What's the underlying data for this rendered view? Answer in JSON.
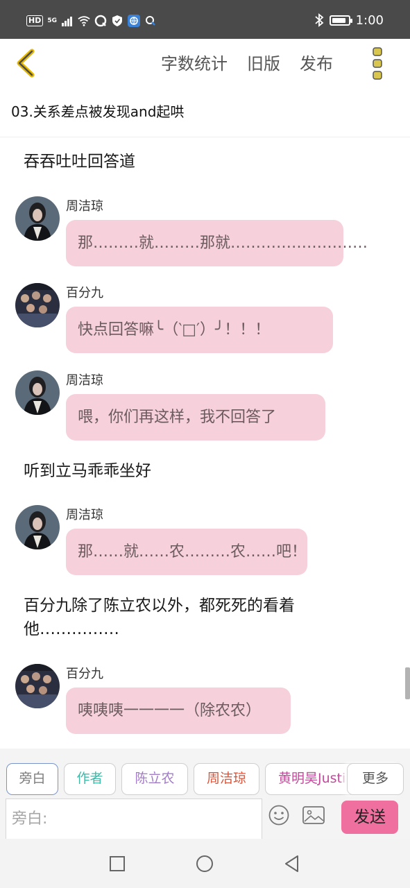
{
  "status_bar": {
    "network_badge": "HD",
    "signal_label": "5G",
    "time": "1:00",
    "battery_level": 0.85
  },
  "top_bar": {
    "actions": [
      "字数统计",
      "旧版",
      "发布"
    ]
  },
  "chapter_title": "03.关系差点被发现and起哄",
  "messages": [
    {
      "type": "narration",
      "text": "吞吞吐吐回答道"
    },
    {
      "type": "chat",
      "sender": "周洁琼",
      "text": "那………就………那就………………………"
    },
    {
      "type": "chat",
      "sender": "百分九",
      "text": "快点回答嘛╰（‵□′）╯！！！"
    },
    {
      "type": "chat",
      "sender": "周洁琼",
      "text": "喂，你们再这样，我不回答了"
    },
    {
      "type": "narration",
      "text": "听到立马乖乖坐好"
    },
    {
      "type": "chat",
      "sender": "周洁琼",
      "text": "那……就……农………农……吧！"
    },
    {
      "type": "narration",
      "text": "百分九除了陈立农以外，都死死的看着他……………"
    },
    {
      "type": "chat",
      "sender": "百分九",
      "text": "咦咦咦一一一一（除农农）"
    }
  ],
  "roles": [
    {
      "label": "旁白",
      "color": "#7c7c7c",
      "selected": true
    },
    {
      "label": "作者",
      "color": "#3fb8a8"
    },
    {
      "label": "陈立农",
      "color": "#a37cc8"
    },
    {
      "label": "周洁琼",
      "color": "#d9573c"
    },
    {
      "label": "黄明昊Justin",
      "color": "#c24a9a"
    }
  ],
  "more_roles_label": "更多",
  "input": {
    "placeholder": "旁白:"
  },
  "send_label": "发送",
  "colors": {
    "bubble": "#f6d0da",
    "send_button": "#ef6f9e",
    "back_arrow": "#e6b800",
    "menu_dots": "#d8c64e"
  }
}
